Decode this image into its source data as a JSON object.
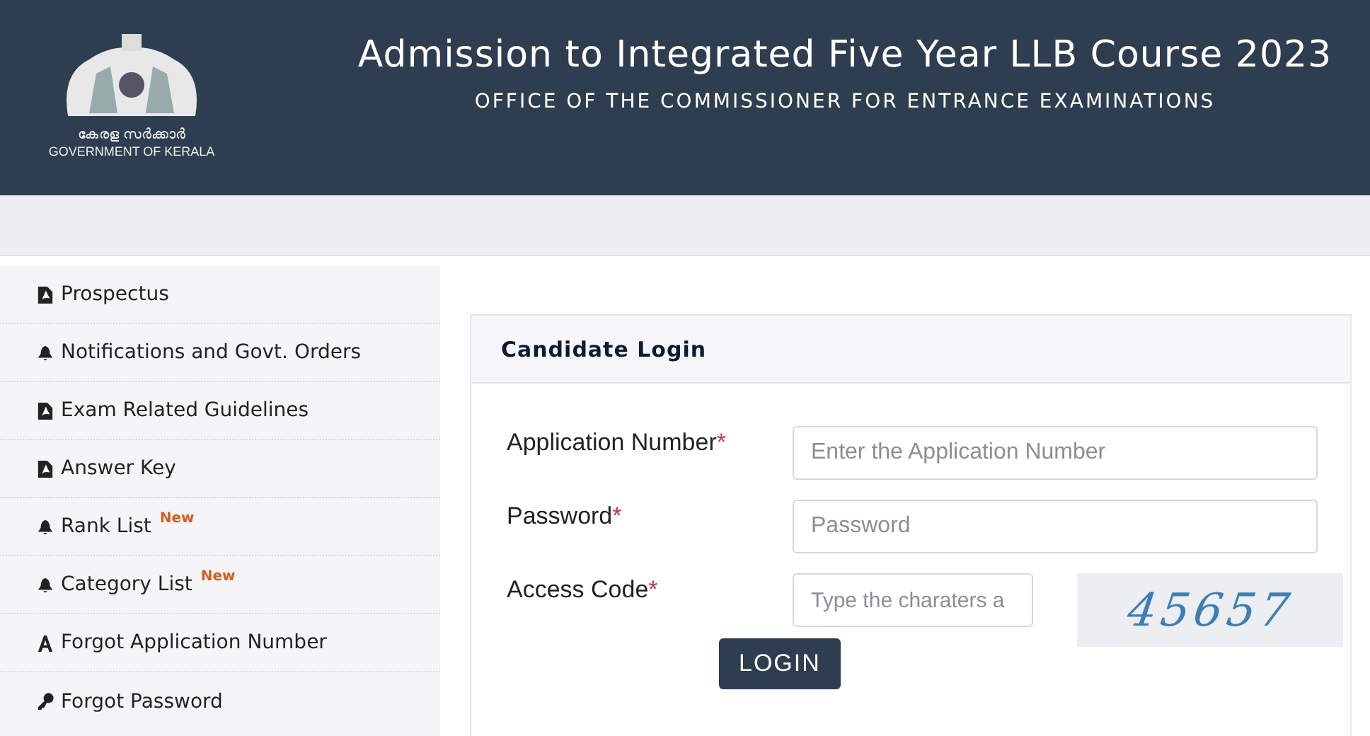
{
  "header": {
    "logo_script": "കേരള സർക്കാർ",
    "logo_caption": "GOVERNMENT OF KERALA",
    "title": "Admission to Integrated Five Year LLB Course 2023",
    "subtitle": "OFFICE OF THE COMMISSIONER FOR ENTRANCE EXAMINATIONS"
  },
  "sidebar": {
    "items": [
      {
        "label": "Prospectus",
        "kind": "document"
      },
      {
        "label": "Notifications and Govt. Orders",
        "kind": "notice"
      },
      {
        "label": "Exam Related Guidelines",
        "kind": "document"
      },
      {
        "label": "Answer Key",
        "kind": "document"
      },
      {
        "label": "Rank List",
        "kind": "notice",
        "badge": "New"
      },
      {
        "label": "Category List",
        "kind": "notice",
        "badge": "New"
      },
      {
        "label": "Forgot Application Number",
        "kind": "recovery"
      },
      {
        "label": "Forgot Password",
        "kind": "password"
      }
    ]
  },
  "login": {
    "title": "Candidate Login",
    "fields": [
      {
        "label": "Application Number",
        "required_mark": "*",
        "placeholder": "Enter the Application Number",
        "kind": "text"
      },
      {
        "label": "Password",
        "required_mark": "*",
        "placeholder": "Password",
        "kind": "text"
      },
      {
        "label": "Access Code",
        "required_mark": "*",
        "placeholder": "Type the charaters a",
        "kind": "captcha",
        "captcha": "45657"
      }
    ],
    "button": "LOGIN"
  }
}
